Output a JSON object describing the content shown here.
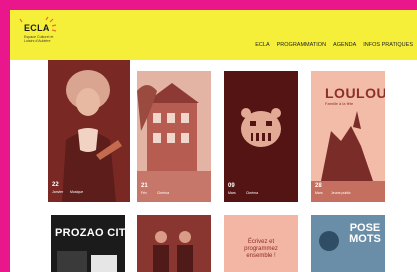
{
  "logo": {
    "name": "ECLA",
    "tagline": "Espace Culturel et Loisirs d'Aubière"
  },
  "nav": {
    "items": [
      "ECLA",
      "PROGRAMMATION",
      "AGENDA",
      "INFOS PRATIQUES"
    ]
  },
  "cards": [
    {
      "day": "22",
      "month": "Janvier",
      "tag": "Musique"
    },
    {
      "day": "21",
      "month": "Fév",
      "tag": "Cinéma"
    },
    {
      "day": "09",
      "month": "Mars",
      "tag": "Cinéma"
    },
    {
      "day": "28",
      "month": "Mars",
      "tag": "Jeune public",
      "title": "LOULOU",
      "subtitle": "Famille à la fête"
    },
    {
      "title": "PROZAO CITY"
    },
    {},
    {
      "title": "Écrivez et programmez ensemble !"
    },
    {
      "title": "POSE MOTS"
    }
  ],
  "colors": {
    "frame": "#e9168c",
    "header": "#f6ef3a"
  }
}
